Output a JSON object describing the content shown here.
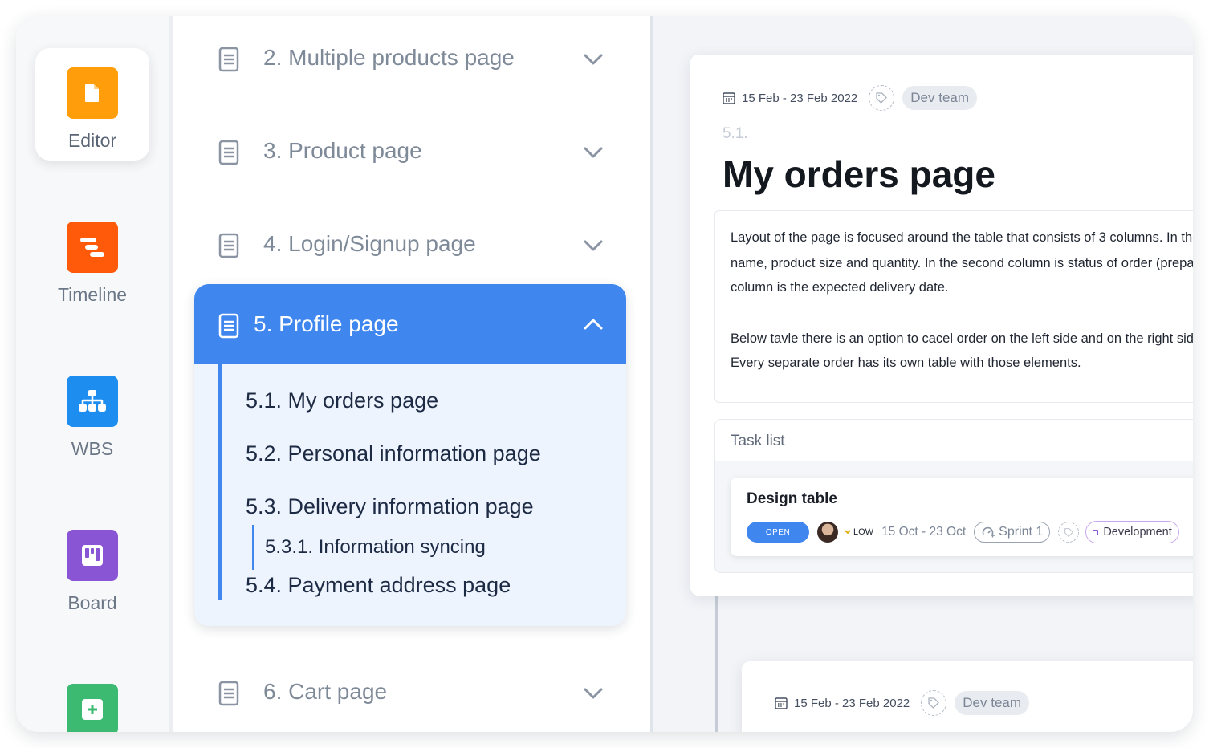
{
  "rail": {
    "items": [
      {
        "label": "Editor",
        "color": "#ff9d0a",
        "icon": "document-icon",
        "active": true
      },
      {
        "label": "Timeline",
        "color": "#ff5a0a",
        "icon": "timeline-icon"
      },
      {
        "label": "WBS",
        "color": "#1e8df0",
        "icon": "hierarchy-icon"
      },
      {
        "label": "Board",
        "color": "#8a55d4",
        "icon": "board-icon"
      },
      {
        "label": "",
        "color": "#3dba71",
        "icon": "plus-icon"
      }
    ]
  },
  "tree": {
    "collapsed_above": [
      {
        "label": "2. Multiple products page"
      },
      {
        "label": "3. Product page"
      },
      {
        "label": "4. Login/Signup page"
      }
    ],
    "open_section": {
      "label": "5. Profile page",
      "children": [
        {
          "label": "5.1. My orders page"
        },
        {
          "label": "5.2. Personal information page"
        },
        {
          "label": "5.3. Delivery information page"
        },
        {
          "label": "5.4. Payment address page"
        }
      ],
      "grandchild": {
        "label": "5.3.1. Information syncing"
      }
    },
    "collapsed_below": [
      {
        "label": "6. Cart page"
      }
    ],
    "accent_color": "#3f87ef"
  },
  "detail": {
    "date_range": "15 Feb - 23 Feb 2022",
    "team": "Dev team",
    "number": "5.1.",
    "title": "My orders page",
    "description_lines": [
      "Layout of the page is focused around the table that consists of 3 columns. In the first column there is product",
      "name, product size and quantity. In the second column is status of order (preparing, shipped, delivered) and the third",
      "column is the expected delivery date.",
      "",
      "Below tavle there is an option to cacel order on the left side and on the right side is the total price.",
      "Every separate order has its own table with those elements."
    ],
    "task_list": {
      "heading": "Task list",
      "task": {
        "title": "Design table",
        "status": "OPEN",
        "priority": "LOW",
        "date": "15 Oct - 23 Oct",
        "sprint": "Sprint 1",
        "label": "Development"
      }
    },
    "next_card": {
      "date_range": "15 Feb - 23 Feb 2022",
      "team": "Dev team"
    }
  }
}
